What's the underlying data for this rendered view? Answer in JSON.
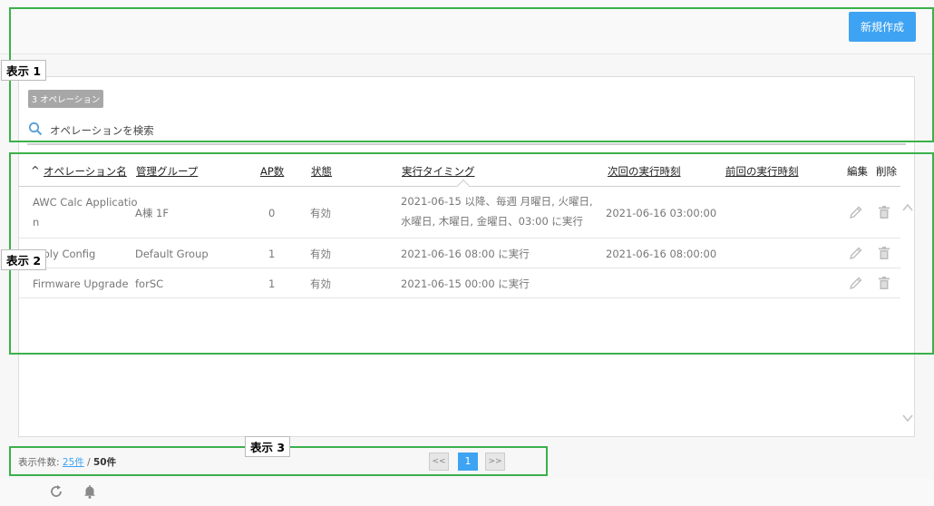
{
  "toolbar": {
    "new_button": "新規作成"
  },
  "operations": {
    "count_badge": "3 オペレーション",
    "search_placeholder": "オペレーションを検索"
  },
  "table": {
    "sort_indicator": "^",
    "headers": {
      "name": "オペレーション名",
      "group": "管理グループ",
      "ap_count": "AP数",
      "status": "状態",
      "timing": "実行タイミング",
      "next_run": "次回の実行時刻",
      "prev_run": "前回の実行時刻",
      "edit": "編集",
      "delete": "削除"
    },
    "rows": [
      {
        "name_line1": "AWC Calc Applicatio",
        "name_line2": "n",
        "group": "A棟 1F",
        "ap_count": "0",
        "status": "有効",
        "timing": "2021-06-15 以降、毎週 月曜日, 火曜日, 水曜日, 木曜日, 金曜日、03:00 に実行",
        "next_run": "2021-06-16 03:00:00",
        "prev_run": ""
      },
      {
        "name": "…ply Config",
        "group": "Default Group",
        "ap_count": "1",
        "status": "有効",
        "timing": "2021-06-16 08:00 に実行",
        "next_run": "2021-06-16 08:00:00",
        "prev_run": ""
      },
      {
        "name": "Firmware Upgrade",
        "group": "forSC",
        "ap_count": "1",
        "status": "有効",
        "timing": "2021-06-15 00:00 に実行",
        "next_run": "",
        "prev_run": ""
      }
    ]
  },
  "annotations": {
    "label1": "表示 1",
    "label2": "表示 2",
    "label3": "表示 3"
  },
  "footer": {
    "count_label": "表示件数:",
    "per_page": "25件",
    "separator": "/",
    "total": "50件"
  },
  "pagination": {
    "prev": "<<",
    "current": "1",
    "next": ">>"
  },
  "colors": {
    "accent": "#3ea3f2",
    "annotation_box": "#3cb04a"
  },
  "icons": [
    "search-icon",
    "pencil-icon",
    "trash-icon",
    "chevron-up-icon",
    "chevron-down-icon",
    "refresh-icon",
    "bell-icon"
  ]
}
